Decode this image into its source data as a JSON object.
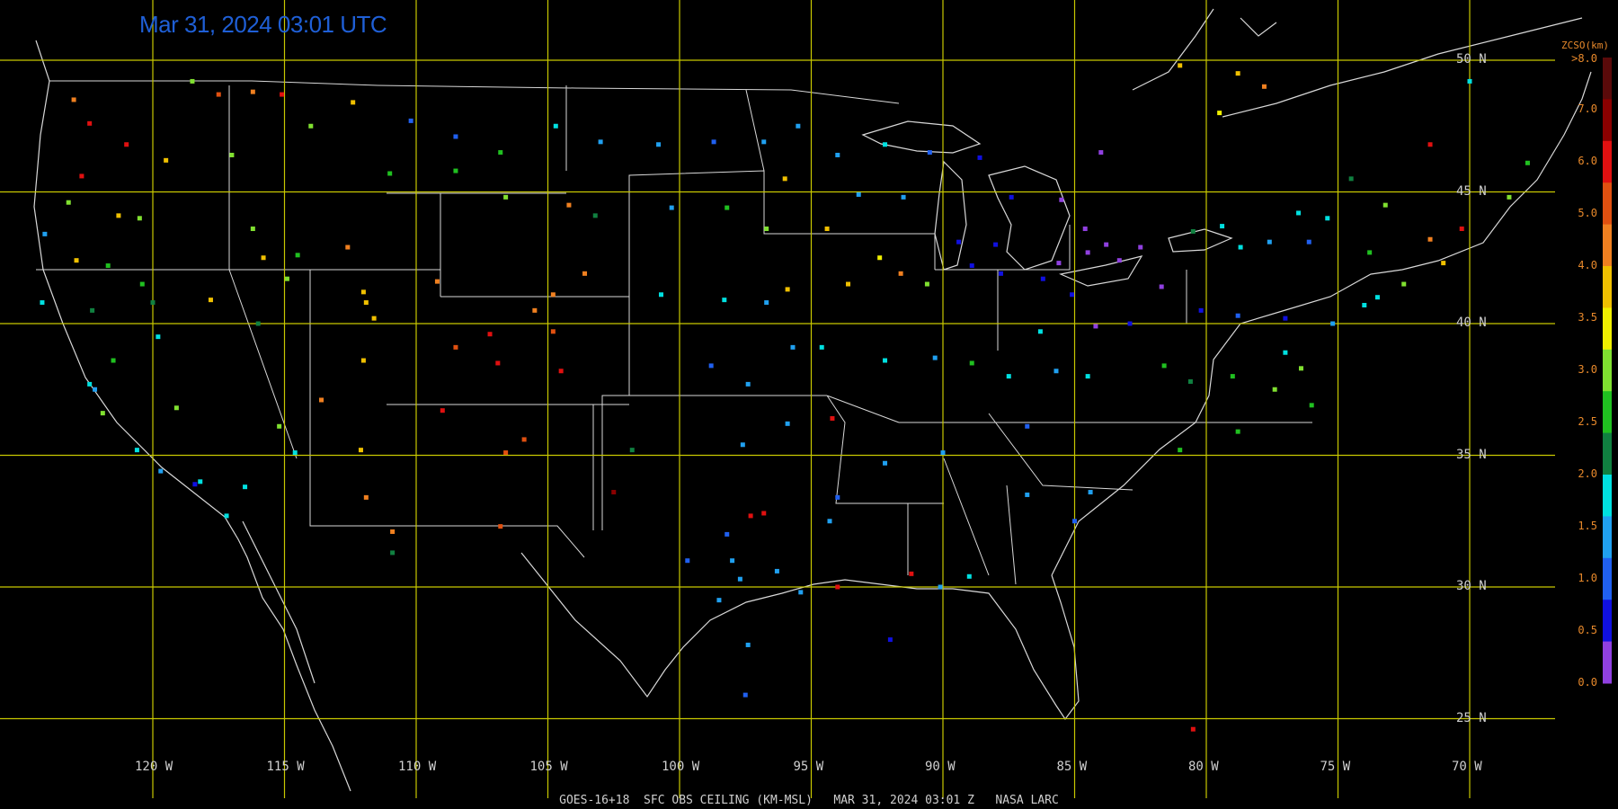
{
  "header": {
    "timestamp": "Mar 31, 2024 03:01 UTC"
  },
  "footer": {
    "caption": "GOES-16+18  SFC OBS CEILING (KM-MSL)   MAR 31, 2024 03:01 Z   NASA LARC"
  },
  "grid": {
    "latitudes": [
      {
        "label": "50 N",
        "value": 50
      },
      {
        "label": "45 N",
        "value": 45
      },
      {
        "label": "40 N",
        "value": 40
      },
      {
        "label": "35 N",
        "value": 35
      },
      {
        "label": "30 N",
        "value": 30
      },
      {
        "label": "25 N",
        "value": 25
      }
    ],
    "longitudes": [
      {
        "label": "120 W",
        "value": -120
      },
      {
        "label": "115 W",
        "value": -115
      },
      {
        "label": "110 W",
        "value": -110
      },
      {
        "label": "105 W",
        "value": -105
      },
      {
        "label": "100 W",
        "value": -100
      },
      {
        "label": "95 W",
        "value": -95
      },
      {
        "label": "90 W",
        "value": -90
      },
      {
        "label": "85 W",
        "value": -85
      },
      {
        "label": "80 W",
        "value": -80
      },
      {
        "label": "75 W",
        "value": -75
      },
      {
        "label": "70 W",
        "value": -70
      }
    ],
    "line_color": "#c8c800"
  },
  "legend": {
    "title": "ZCSO(km)",
    "top_label": ">8.0",
    "labels": [
      "7.0",
      "6.0",
      "5.0",
      "4.0",
      "3.5",
      "3.0",
      "2.5",
      "2.0",
      "1.5",
      "1.0",
      "0.5",
      "0.0"
    ],
    "colors": [
      "#5a0a0a",
      "#8b0000",
      "#e01010",
      "#e05010",
      "#f08020",
      "#f0c000",
      "#f0f000",
      "#80e030",
      "#20c020",
      "#108040",
      "#00e0e0",
      "#20a0f0",
      "#2060f0",
      "#1010e0",
      "#9040e0"
    ]
  },
  "stations": [
    {
      "lon": -122.4,
      "lat": 47.6,
      "c": "#e01010"
    },
    {
      "lon": -123.0,
      "lat": 48.5,
      "c": "#f08020"
    },
    {
      "lon": -121.0,
      "lat": 46.8,
      "c": "#e01010"
    },
    {
      "lon": -118.5,
      "lat": 49.2,
      "c": "#80e030"
    },
    {
      "lon": -117.5,
      "lat": 48.7,
      "c": "#e05010"
    },
    {
      "lon": -116.2,
      "lat": 48.8,
      "c": "#f08020"
    },
    {
      "lon": -115.1,
      "lat": 48.7,
      "c": "#e01010"
    },
    {
      "lon": -114.0,
      "lat": 47.5,
      "c": "#80e030"
    },
    {
      "lon": -112.4,
      "lat": 48.4,
      "c": "#f0c000"
    },
    {
      "lon": -110.2,
      "lat": 47.7,
      "c": "#2060f0"
    },
    {
      "lon": -108.5,
      "lat": 47.1,
      "c": "#2060f0"
    },
    {
      "lon": -106.8,
      "lat": 46.5,
      "c": "#20c020"
    },
    {
      "lon": -104.7,
      "lat": 47.5,
      "c": "#00e0e0"
    },
    {
      "lon": -103.0,
      "lat": 46.9,
      "c": "#20a0f0"
    },
    {
      "lon": -100.8,
      "lat": 46.8,
      "c": "#20a0f0"
    },
    {
      "lon": -98.7,
      "lat": 46.9,
      "c": "#2060f0"
    },
    {
      "lon": -96.8,
      "lat": 46.9,
      "c": "#20a0f0"
    },
    {
      "lon": -95.5,
      "lat": 47.5,
      "c": "#20a0f0"
    },
    {
      "lon": -94.0,
      "lat": 46.4,
      "c": "#20a0f0"
    },
    {
      "lon": -92.2,
      "lat": 46.8,
      "c": "#00e0e0"
    },
    {
      "lon": -90.5,
      "lat": 46.5,
      "c": "#2060f0"
    },
    {
      "lon": -88.6,
      "lat": 46.3,
      "c": "#1010e0"
    },
    {
      "lon": -87.4,
      "lat": 44.8,
      "c": "#1010e0"
    },
    {
      "lon": -85.5,
      "lat": 44.7,
      "c": "#9040e0"
    },
    {
      "lon": -84.6,
      "lat": 43.6,
      "c": "#9040e0"
    },
    {
      "lon": -83.8,
      "lat": 43.0,
      "c": "#9040e0"
    },
    {
      "lon": -83.3,
      "lat": 42.4,
      "c": "#9040e0"
    },
    {
      "lon": -84.5,
      "lat": 42.7,
      "c": "#9040e0"
    },
    {
      "lon": -85.6,
      "lat": 42.3,
      "c": "#9040e0"
    },
    {
      "lon": -86.2,
      "lat": 41.7,
      "c": "#1010e0"
    },
    {
      "lon": -87.8,
      "lat": 41.9,
      "c": "#1010e0"
    },
    {
      "lon": -88.9,
      "lat": 42.2,
      "c": "#1010e0"
    },
    {
      "lon": -89.4,
      "lat": 43.1,
      "c": "#1010e0"
    },
    {
      "lon": -88.0,
      "lat": 43.0,
      "c": "#1010e0"
    },
    {
      "lon": -86.3,
      "lat": 39.7,
      "c": "#00e0e0"
    },
    {
      "lon": -85.1,
      "lat": 41.1,
      "c": "#1010e0"
    },
    {
      "lon": -84.2,
      "lat": 39.9,
      "c": "#9040e0"
    },
    {
      "lon": -82.9,
      "lat": 40.0,
      "c": "#1010e0"
    },
    {
      "lon": -81.7,
      "lat": 41.4,
      "c": "#9040e0"
    },
    {
      "lon": -80.2,
      "lat": 40.5,
      "c": "#1010e0"
    },
    {
      "lon": -78.8,
      "lat": 40.3,
      "c": "#2060f0"
    },
    {
      "lon": -77.0,
      "lat": 40.2,
      "c": "#1010e0"
    },
    {
      "lon": -75.2,
      "lat": 40.0,
      "c": "#20a0f0"
    },
    {
      "lon": -74.0,
      "lat": 40.7,
      "c": "#00e0e0"
    },
    {
      "lon": -73.5,
      "lat": 41.0,
      "c": "#00e0e0"
    },
    {
      "lon": -72.5,
      "lat": 41.5,
      "c": "#80e030"
    },
    {
      "lon": -71.0,
      "lat": 42.3,
      "c": "#f0c000"
    },
    {
      "lon": -70.3,
      "lat": 43.6,
      "c": "#e01010"
    },
    {
      "lon": -73.8,
      "lat": 42.7,
      "c": "#20c020"
    },
    {
      "lon": -76.1,
      "lat": 43.1,
      "c": "#2060f0"
    },
    {
      "lon": -78.7,
      "lat": 42.9,
      "c": "#00e0e0"
    },
    {
      "lon": -77.6,
      "lat": 43.1,
      "c": "#20a0f0"
    },
    {
      "lon": -75.4,
      "lat": 44.0,
      "c": "#00e0e0"
    },
    {
      "lon": -73.2,
      "lat": 44.5,
      "c": "#80e030"
    },
    {
      "lon": -71.5,
      "lat": 43.2,
      "c": "#f08020"
    },
    {
      "lon": -77.4,
      "lat": 37.5,
      "c": "#80e030"
    },
    {
      "lon": -76.4,
      "lat": 38.3,
      "c": "#80e030"
    },
    {
      "lon": -77.0,
      "lat": 38.9,
      "c": "#00e0e0"
    },
    {
      "lon": -79.0,
      "lat": 38.0,
      "c": "#20c020"
    },
    {
      "lon": -80.6,
      "lat": 37.8,
      "c": "#108040"
    },
    {
      "lon": -81.6,
      "lat": 38.4,
      "c": "#20c020"
    },
    {
      "lon": -84.5,
      "lat": 38.0,
      "c": "#00e0e0"
    },
    {
      "lon": -85.7,
      "lat": 38.2,
      "c": "#20a0f0"
    },
    {
      "lon": -87.5,
      "lat": 38.0,
      "c": "#00e0e0"
    },
    {
      "lon": -88.9,
      "lat": 38.5,
      "c": "#20c020"
    },
    {
      "lon": -90.3,
      "lat": 38.7,
      "c": "#20a0f0"
    },
    {
      "lon": -92.2,
      "lat": 38.6,
      "c": "#00e0e0"
    },
    {
      "lon": -94.6,
      "lat": 39.1,
      "c": "#00e0e0"
    },
    {
      "lon": -95.7,
      "lat": 39.1,
      "c": "#20a0f0"
    },
    {
      "lon": -97.4,
      "lat": 37.7,
      "c": "#20a0f0"
    },
    {
      "lon": -98.8,
      "lat": 38.4,
      "c": "#2060f0"
    },
    {
      "lon": -97.6,
      "lat": 35.4,
      "c": "#20a0f0"
    },
    {
      "lon": -95.9,
      "lat": 36.2,
      "c": "#20a0f0"
    },
    {
      "lon": -94.2,
      "lat": 36.4,
      "c": "#e01010"
    },
    {
      "lon": -92.2,
      "lat": 34.7,
      "c": "#20a0f0"
    },
    {
      "lon": -90.0,
      "lat": 35.1,
      "c": "#20a0f0"
    },
    {
      "lon": -86.8,
      "lat": 36.1,
      "c": "#2060f0"
    },
    {
      "lon": -96.8,
      "lat": 32.8,
      "c": "#e01010"
    },
    {
      "lon": -97.3,
      "lat": 32.7,
      "c": "#e01010"
    },
    {
      "lon": -97.7,
      "lat": 30.3,
      "c": "#20a0f0"
    },
    {
      "lon": -98.5,
      "lat": 29.5,
      "c": "#20a0f0"
    },
    {
      "lon": -95.4,
      "lat": 29.8,
      "c": "#20a0f0"
    },
    {
      "lon": -94.0,
      "lat": 30.0,
      "c": "#e01010"
    },
    {
      "lon": -97.4,
      "lat": 27.8,
      "c": "#20a0f0"
    },
    {
      "lon": -97.5,
      "lat": 25.9,
      "c": "#2060f0"
    },
    {
      "lon": -91.2,
      "lat": 30.5,
      "c": "#e01010"
    },
    {
      "lon": -90.1,
      "lat": 30.0,
      "c": "#20a0f0"
    },
    {
      "lon": -92.0,
      "lat": 28.0,
      "c": "#1010e0"
    },
    {
      "lon": -106.6,
      "lat": 35.1,
      "c": "#e05010"
    },
    {
      "lon": -105.9,
      "lat": 35.6,
      "c": "#e05010"
    },
    {
      "lon": -106.8,
      "lat": 32.3,
      "c": "#e05010"
    },
    {
      "lon": -104.5,
      "lat": 38.2,
      "c": "#e01010"
    },
    {
      "lon": -104.8,
      "lat": 39.7,
      "c": "#e05010"
    },
    {
      "lon": -105.5,
      "lat": 40.5,
      "c": "#f08020"
    },
    {
      "lon": -107.2,
      "lat": 39.6,
      "c": "#e01010"
    },
    {
      "lon": -108.5,
      "lat": 39.1,
      "c": "#e05010"
    },
    {
      "lon": -106.9,
      "lat": 38.5,
      "c": "#e01010"
    },
    {
      "lon": -111.9,
      "lat": 40.8,
      "c": "#f0c000"
    },
    {
      "lon": -112.0,
      "lat": 41.2,
      "c": "#f0c000"
    },
    {
      "lon": -111.6,
      "lat": 40.2,
      "c": "#f0c000"
    },
    {
      "lon": -109.2,
      "lat": 41.6,
      "c": "#f08020"
    },
    {
      "lon": -110.9,
      "lat": 32.1,
      "c": "#f08020"
    },
    {
      "lon": -111.9,
      "lat": 33.4,
      "c": "#f08020"
    },
    {
      "lon": -112.1,
      "lat": 35.2,
      "c": "#f0c000"
    },
    {
      "lon": -114.6,
      "lat": 35.1,
      "c": "#00e0e0"
    },
    {
      "lon": -115.2,
      "lat": 36.1,
      "c": "#80e030"
    },
    {
      "lon": -116.5,
      "lat": 33.8,
      "c": "#00e0e0"
    },
    {
      "lon": -117.2,
      "lat": 32.7,
      "c": "#00e0e0"
    },
    {
      "lon": -118.2,
      "lat": 34.0,
      "c": "#00e0e0"
    },
    {
      "lon": -118.4,
      "lat": 33.9,
      "c": "#1010e0"
    },
    {
      "lon": -119.7,
      "lat": 34.4,
      "c": "#20a0f0"
    },
    {
      "lon": -120.6,
      "lat": 35.2,
      "c": "#00e0e0"
    },
    {
      "lon": -121.9,
      "lat": 36.6,
      "c": "#80e030"
    },
    {
      "lon": -122.4,
      "lat": 37.7,
      "c": "#00e0e0"
    },
    {
      "lon": -122.2,
      "lat": 37.5,
      "c": "#20a0f0"
    },
    {
      "lon": -121.5,
      "lat": 38.6,
      "c": "#20c020"
    },
    {
      "lon": -119.8,
      "lat": 39.5,
      "c": "#00e0e0"
    },
    {
      "lon": -119.1,
      "lat": 36.8,
      "c": "#80e030"
    },
    {
      "lon": -117.8,
      "lat": 40.9,
      "c": "#f0c000"
    },
    {
      "lon": -116.0,
      "lat": 40.0,
      "c": "#108040"
    },
    {
      "lon": -115.8,
      "lat": 42.5,
      "c": "#f0c000"
    },
    {
      "lon": -116.2,
      "lat": 43.6,
      "c": "#80e030"
    },
    {
      "lon": -114.5,
      "lat": 42.6,
      "c": "#20c020"
    },
    {
      "lon": -112.6,
      "lat": 42.9,
      "c": "#f08020"
    },
    {
      "lon": -111.0,
      "lat": 45.7,
      "c": "#20c020"
    },
    {
      "lon": -108.5,
      "lat": 45.8,
      "c": "#20c020"
    },
    {
      "lon": -106.6,
      "lat": 44.8,
      "c": "#80e030"
    },
    {
      "lon": -104.2,
      "lat": 44.5,
      "c": "#f08020"
    },
    {
      "lon": -103.2,
      "lat": 44.1,
      "c": "#108040"
    },
    {
      "lon": -100.3,
      "lat": 44.4,
      "c": "#20a0f0"
    },
    {
      "lon": -98.2,
      "lat": 44.4,
      "c": "#20c020"
    },
    {
      "lon": -96.7,
      "lat": 43.6,
      "c": "#80e030"
    },
    {
      "lon": -95.9,
      "lat": 41.3,
      "c": "#f0c000"
    },
    {
      "lon": -96.7,
      "lat": 40.8,
      "c": "#20a0f0"
    },
    {
      "lon": -98.3,
      "lat": 40.9,
      "c": "#00e0e0"
    },
    {
      "lon": -100.7,
      "lat": 41.1,
      "c": "#00e0e0"
    },
    {
      "lon": -103.6,
      "lat": 41.9,
      "c": "#f08020"
    },
    {
      "lon": -104.8,
      "lat": 41.1,
      "c": "#f08020"
    },
    {
      "lon": -93.6,
      "lat": 41.5,
      "c": "#f0c000"
    },
    {
      "lon": -92.4,
      "lat": 42.5,
      "c": "#f0f000"
    },
    {
      "lon": -91.6,
      "lat": 41.9,
      "c": "#f08020"
    },
    {
      "lon": -90.6,
      "lat": 41.5,
      "c": "#80e030"
    },
    {
      "lon": -93.2,
      "lat": 44.9,
      "c": "#20a0f0"
    },
    {
      "lon": -94.4,
      "lat": 43.6,
      "c": "#f0c000"
    },
    {
      "lon": -91.5,
      "lat": 44.8,
      "c": "#20a0f0"
    },
    {
      "lon": -96.0,
      "lat": 45.5,
      "c": "#f0c000"
    },
    {
      "lon": -84.0,
      "lat": 46.5,
      "c": "#9040e0"
    },
    {
      "lon": -82.5,
      "lat": 42.9,
      "c": "#9040e0"
    },
    {
      "lon": -80.5,
      "lat": 43.5,
      "c": "#108040"
    },
    {
      "lon": -79.4,
      "lat": 43.7,
      "c": "#00e0e0"
    },
    {
      "lon": -76.5,
      "lat": 44.2,
      "c": "#00e0e0"
    },
    {
      "lon": -74.5,
      "lat": 45.5,
      "c": "#108040"
    },
    {
      "lon": -71.5,
      "lat": 46.8,
      "c": "#e01010"
    },
    {
      "lon": -68.5,
      "lat": 44.8,
      "c": "#80e030"
    },
    {
      "lon": -67.8,
      "lat": 46.1,
      "c": "#20c020"
    },
    {
      "lon": -70.0,
      "lat": 49.2,
      "c": "#00e0e0"
    },
    {
      "lon": -78.8,
      "lat": 49.5,
      "c": "#f0c000"
    },
    {
      "lon": -79.5,
      "lat": 48.0,
      "c": "#f0f000"
    },
    {
      "lon": -77.8,
      "lat": 49.0,
      "c": "#f08020"
    },
    {
      "lon": -81.0,
      "lat": 49.8,
      "c": "#f0c000"
    },
    {
      "lon": -80.5,
      "lat": 24.6,
      "c": "#e01010"
    },
    {
      "lon": -86.8,
      "lat": 33.5,
      "c": "#20a0f0"
    },
    {
      "lon": -89.0,
      "lat": 30.4,
      "c": "#00e0e0"
    },
    {
      "lon": -85.0,
      "lat": 32.5,
      "c": "#2060f0"
    },
    {
      "lon": -84.4,
      "lat": 33.6,
      "c": "#20a0f0"
    },
    {
      "lon": -81.0,
      "lat": 35.2,
      "c": "#20c020"
    },
    {
      "lon": -78.8,
      "lat": 35.9,
      "c": "#20c020"
    },
    {
      "lon": -76.0,
      "lat": 36.9,
      "c": "#20c020"
    },
    {
      "lon": -102.5,
      "lat": 33.6,
      "c": "#8b0000"
    },
    {
      "lon": -101.8,
      "lat": 35.2,
      "c": "#108040"
    },
    {
      "lon": -99.7,
      "lat": 31.0,
      "c": "#2060f0"
    },
    {
      "lon": -98.0,
      "lat": 31.0,
      "c": "#20a0f0"
    },
    {
      "lon": -98.2,
      "lat": 32.0,
      "c": "#2060f0"
    },
    {
      "lon": -96.3,
      "lat": 30.6,
      "c": "#20a0f0"
    },
    {
      "lon": -94.3,
      "lat": 32.5,
      "c": "#20a0f0"
    },
    {
      "lon": -94.0,
      "lat": 33.4,
      "c": "#2060f0"
    },
    {
      "lon": -110.9,
      "lat": 31.3,
      "c": "#108040"
    },
    {
      "lon": -109.0,
      "lat": 36.7,
      "c": "#e01010"
    },
    {
      "lon": -113.6,
      "lat": 37.1,
      "c": "#f08020"
    },
    {
      "lon": -112.0,
      "lat": 38.6,
      "c": "#f0c000"
    },
    {
      "lon": -114.9,
      "lat": 41.7,
      "c": "#80e030"
    },
    {
      "lon": -117.0,
      "lat": 46.4,
      "c": "#80e030"
    },
    {
      "lon": -119.5,
      "lat": 46.2,
      "c": "#f0c000"
    },
    {
      "lon": -120.5,
      "lat": 44.0,
      "c": "#80e030"
    },
    {
      "lon": -121.3,
      "lat": 44.1,
      "c": "#f0c000"
    },
    {
      "lon": -123.2,
      "lat": 44.6,
      "c": "#80e030"
    },
    {
      "lon": -122.7,
      "lat": 45.6,
      "c": "#e01010"
    },
    {
      "lon": -124.1,
      "lat": 43.4,
      "c": "#20a0f0"
    },
    {
      "lon": -122.9,
      "lat": 42.4,
      "c": "#f0c000"
    },
    {
      "lon": -121.7,
      "lat": 42.2,
      "c": "#20c020"
    },
    {
      "lon": -120.4,
      "lat": 41.5,
      "c": "#20c020"
    },
    {
      "lon": -124.2,
      "lat": 40.8,
      "c": "#00e0e0"
    },
    {
      "lon": -122.3,
      "lat": 40.5,
      "c": "#108040"
    },
    {
      "lon": -120.0,
      "lat": 40.8,
      "c": "#108040"
    }
  ]
}
